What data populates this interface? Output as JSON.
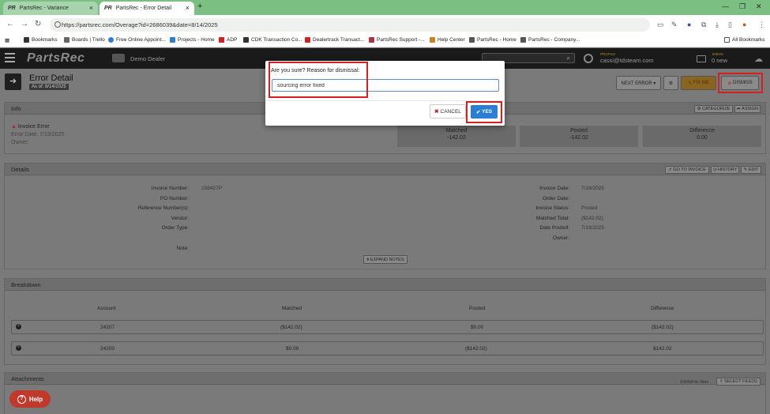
{
  "browser": {
    "tabs": [
      {
        "label": "PartsRec - Variance",
        "favicon": "PR"
      },
      {
        "label": "PartsRec - Error Detail",
        "favicon": "PR"
      }
    ],
    "url": "https://partsrec.com/Overage?id=2686039&date=8/14/2025",
    "bookmarks": [
      "Bookmarks",
      "Boards | Trello",
      "Free Online Appoint...",
      "Projects - Home",
      "ADP",
      "CDK Transaction Co...",
      "Dealertrack Transact...",
      "PartsRec Support -...",
      "Help Center",
      "PartsRec - Home",
      "PartsRec - Company..."
    ],
    "all_bookmarks": "All Bookmarks"
  },
  "app": {
    "logo": "PartsRec",
    "dealer": "Demo Dealer",
    "profile_label": "PROFILE",
    "profile_email": "cassi@tdsteam.com",
    "inbox_label": "INBOX",
    "inbox_value": "0 new"
  },
  "page": {
    "title": "Error Detail",
    "as_of": "As of: 8/14/2025",
    "next_error": "NEXT ERROR ▾",
    "fix_me": "FIX ME",
    "dismiss": "DISMISS"
  },
  "info": {
    "title": "Info",
    "categorize": "CATEGORIZE",
    "assign": "ASSIGN",
    "error_type": "Invoice Error",
    "error_date": "Error Date: 7/19/2025",
    "owner": "Owner:",
    "stats": [
      {
        "label": "Matched",
        "value": "-142.02"
      },
      {
        "label": "Posted",
        "value": "-142.02"
      },
      {
        "label": "Difference",
        "value": "0.00"
      }
    ]
  },
  "details": {
    "title": "Details",
    "go_to_invoice": "GO TO INVOICE",
    "history": "HISTORY",
    "edit": "EDIT",
    "left_fields": [
      {
        "label": "Invoice Number:",
        "value": "158427P"
      },
      {
        "label": "PO Number:",
        "value": ""
      },
      {
        "label": "Reference Number(s):",
        "value": ""
      },
      {
        "label": "Vendor:",
        "value": ""
      },
      {
        "label": "Order Type:",
        "value": ""
      },
      {
        "label": "Note:",
        "value": ""
      }
    ],
    "right_fields": [
      {
        "label": "Invoice Date:",
        "value": "7/19/2025"
      },
      {
        "label": "Order Date:",
        "value": ""
      },
      {
        "label": "Invoice Status:",
        "value": "Posted"
      },
      {
        "label": "Matched Total:",
        "value": "($142.02)"
      },
      {
        "label": "Date Posted:",
        "value": "7/19/2025"
      },
      {
        "label": "Owner:",
        "value": ""
      }
    ],
    "expand_notes": "EXPAND NOTES"
  },
  "breakdown": {
    "title": "Breakdown",
    "columns": [
      "Account",
      "Matched",
      "Posted",
      "Difference"
    ],
    "rows": [
      [
        "24207",
        "($142.02)",
        "$0.00",
        "($142.02)"
      ],
      [
        "24200",
        "$0.00",
        "($142.02)",
        "$142.02"
      ]
    ]
  },
  "attachments": {
    "title": "Attachments",
    "max_note": "10Mb/File Max",
    "select_files": "SELECT FILE(S)"
  },
  "modal": {
    "prompt": "Are you sure? Reason for dismissal:",
    "input_value": "sourcing error fixed",
    "cancel": "CANCEL",
    "yes": "YES"
  },
  "help": "Help",
  "colors": {
    "tab_bar": "#7bbf83",
    "highlight": "#d42020",
    "yes_button": "#2a7fd4",
    "help_button": "#c0392b",
    "fix_me": "#8a6520"
  }
}
